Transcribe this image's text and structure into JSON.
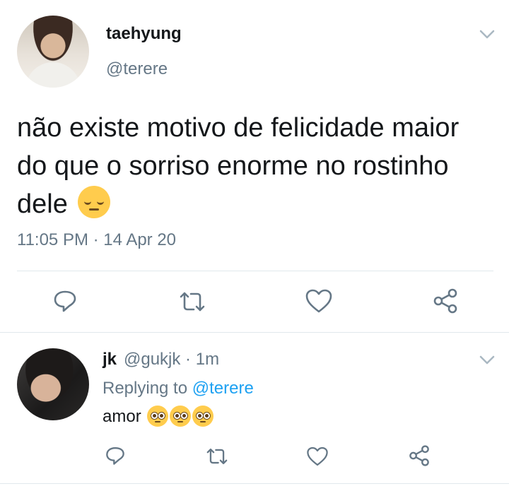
{
  "tweet": {
    "display_name": "taehyung",
    "handle": "@terere",
    "text": "não existe motivo de felicidade maior do que o sorriso enorme no rostinho dele",
    "emoji": "pensive-face",
    "time": "11:05 PM",
    "separator": " · ",
    "date": "14 Apr 20"
  },
  "reply": {
    "display_name": "jk",
    "handle": "@gukjk",
    "dot": " · ",
    "age": "1m",
    "replying_prefix": "Replying to ",
    "replying_to": "@terere",
    "text": "amor",
    "emojis": [
      "pleading-face",
      "pleading-face",
      "pleading-face"
    ]
  },
  "actions": [
    "reply-icon",
    "retweet-icon",
    "like-icon",
    "share-icon"
  ],
  "colors": {
    "text": "#14171a",
    "secondary": "#657786",
    "link": "#1da1f2",
    "icon": "#657786",
    "divider": "#e1e8ed",
    "emoji": "#ffcc4d"
  }
}
